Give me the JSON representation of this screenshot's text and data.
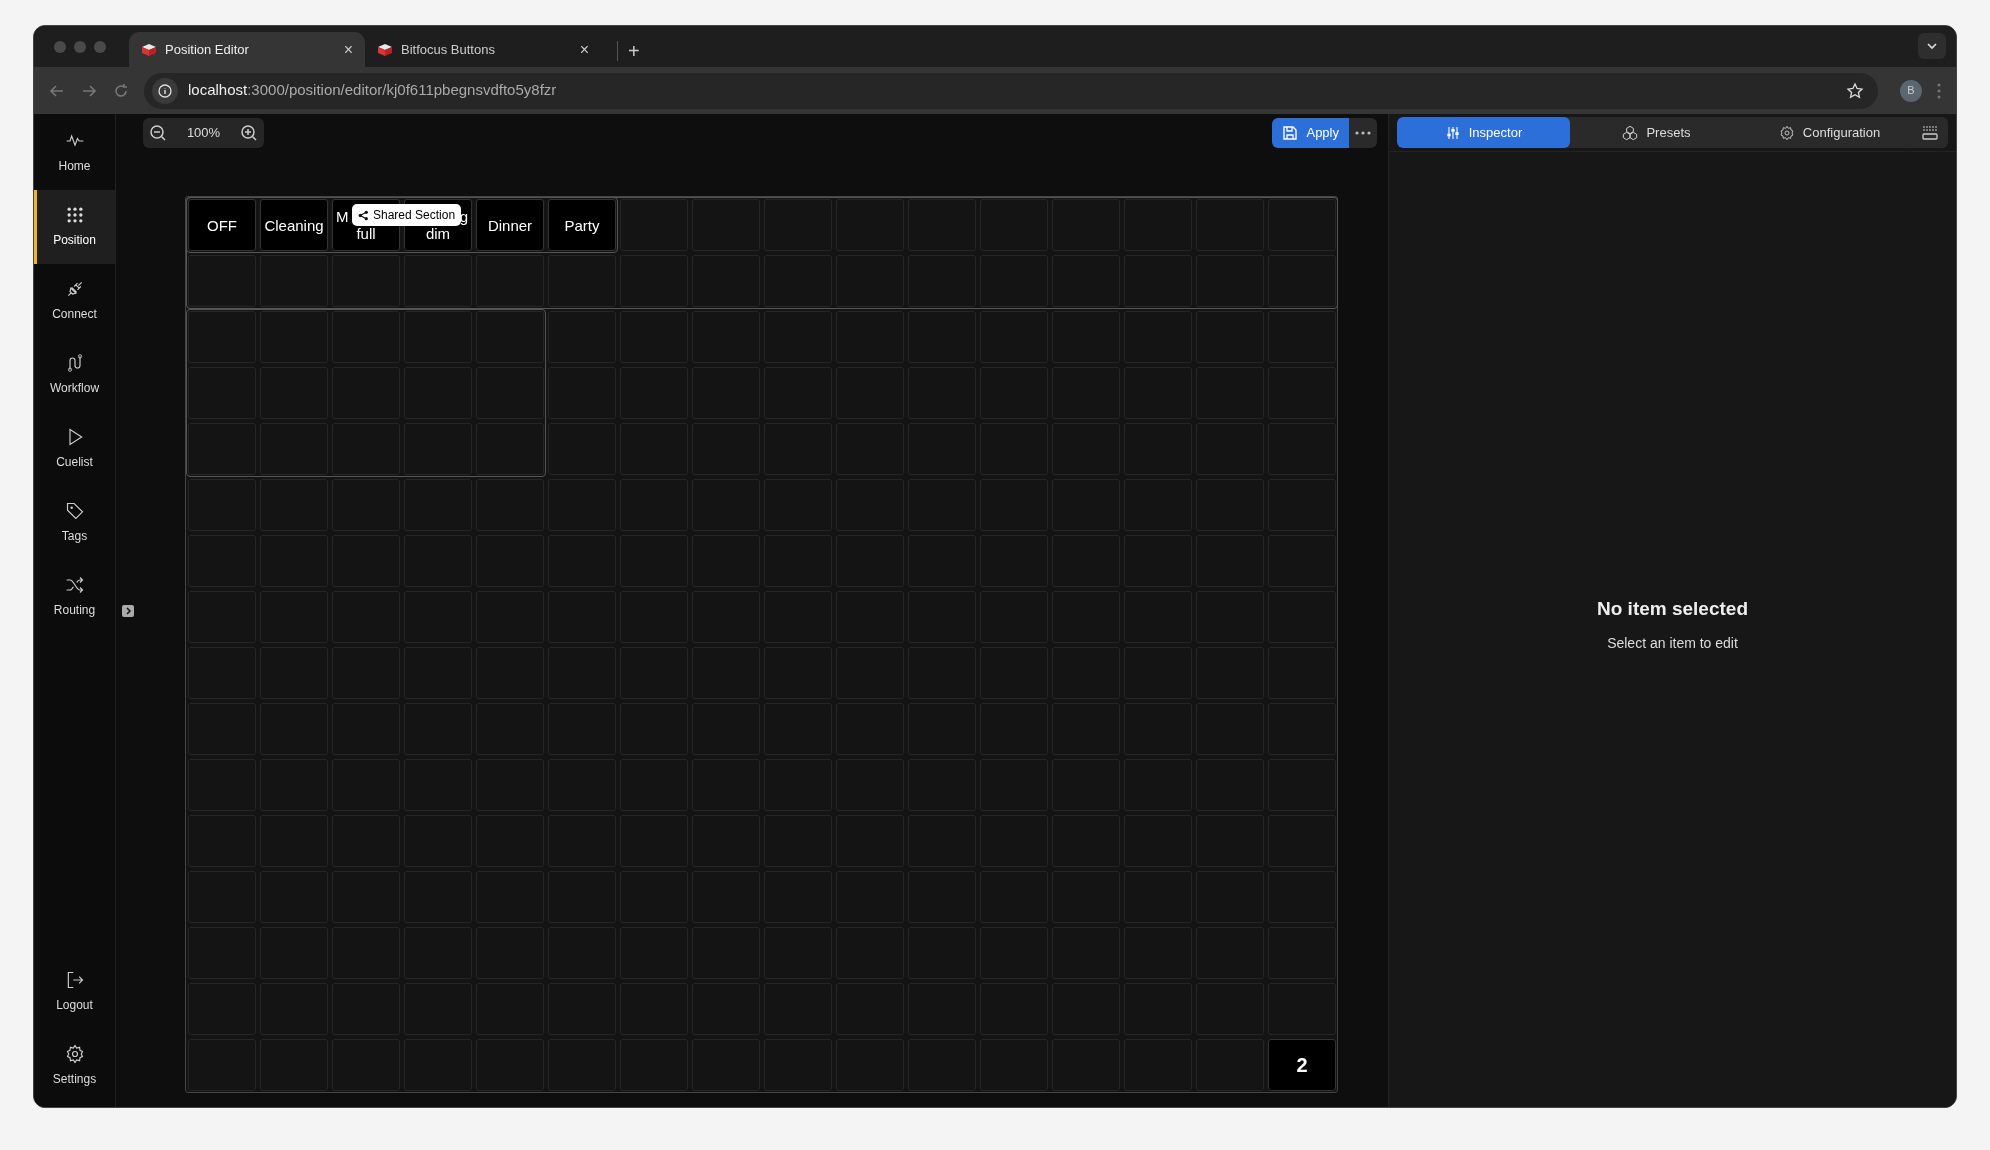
{
  "browser": {
    "tabs": [
      {
        "title": "Position Editor",
        "selected": true,
        "close": "×"
      },
      {
        "title": "Bitfocus Buttons",
        "selected": false,
        "close": "×"
      }
    ],
    "new_tab": "+",
    "url": {
      "host": "localhost",
      "path": ":3000/position/editor/kj0f611pbegnsvdfto5y8fzr"
    },
    "profile": "B"
  },
  "sidebar": {
    "items": [
      {
        "label": "Home",
        "selected": false
      },
      {
        "label": "Position",
        "selected": true
      },
      {
        "label": "Connect",
        "selected": false
      },
      {
        "label": "Workflow",
        "selected": false
      },
      {
        "label": "Cuelist",
        "selected": false
      },
      {
        "label": "Tags",
        "selected": false
      },
      {
        "label": "Routing",
        "selected": false
      }
    ],
    "bottom_items": [
      {
        "label": "Logout",
        "selected": false
      },
      {
        "label": "Settings",
        "selected": false
      }
    ]
  },
  "toolbar": {
    "zoom": "100%",
    "apply": "Apply"
  },
  "grid": {
    "top_buttons": [
      {
        "kind": "plain",
        "lines": [
          "OFF"
        ]
      },
      {
        "kind": "plain",
        "lines": [
          "Cleaning"
        ]
      },
      {
        "kind": "covered_end",
        "lines": [
          "M",
          "full"
        ]
      },
      {
        "kind": "covered_start",
        "lines": [
          "g",
          "dim"
        ]
      },
      {
        "kind": "plain",
        "lines": [
          "Dinner"
        ]
      },
      {
        "kind": "plain",
        "lines": [
          "Party"
        ]
      }
    ],
    "corner_button": "2",
    "tooltip": "Shared Section"
  },
  "panel": {
    "tabs": [
      {
        "label": "Inspector",
        "selected": true
      },
      {
        "label": "Presets",
        "selected": false
      },
      {
        "label": "Configuration",
        "selected": false
      }
    ],
    "empty_title": "No item selected",
    "empty_hint": "Select an item to edit"
  }
}
